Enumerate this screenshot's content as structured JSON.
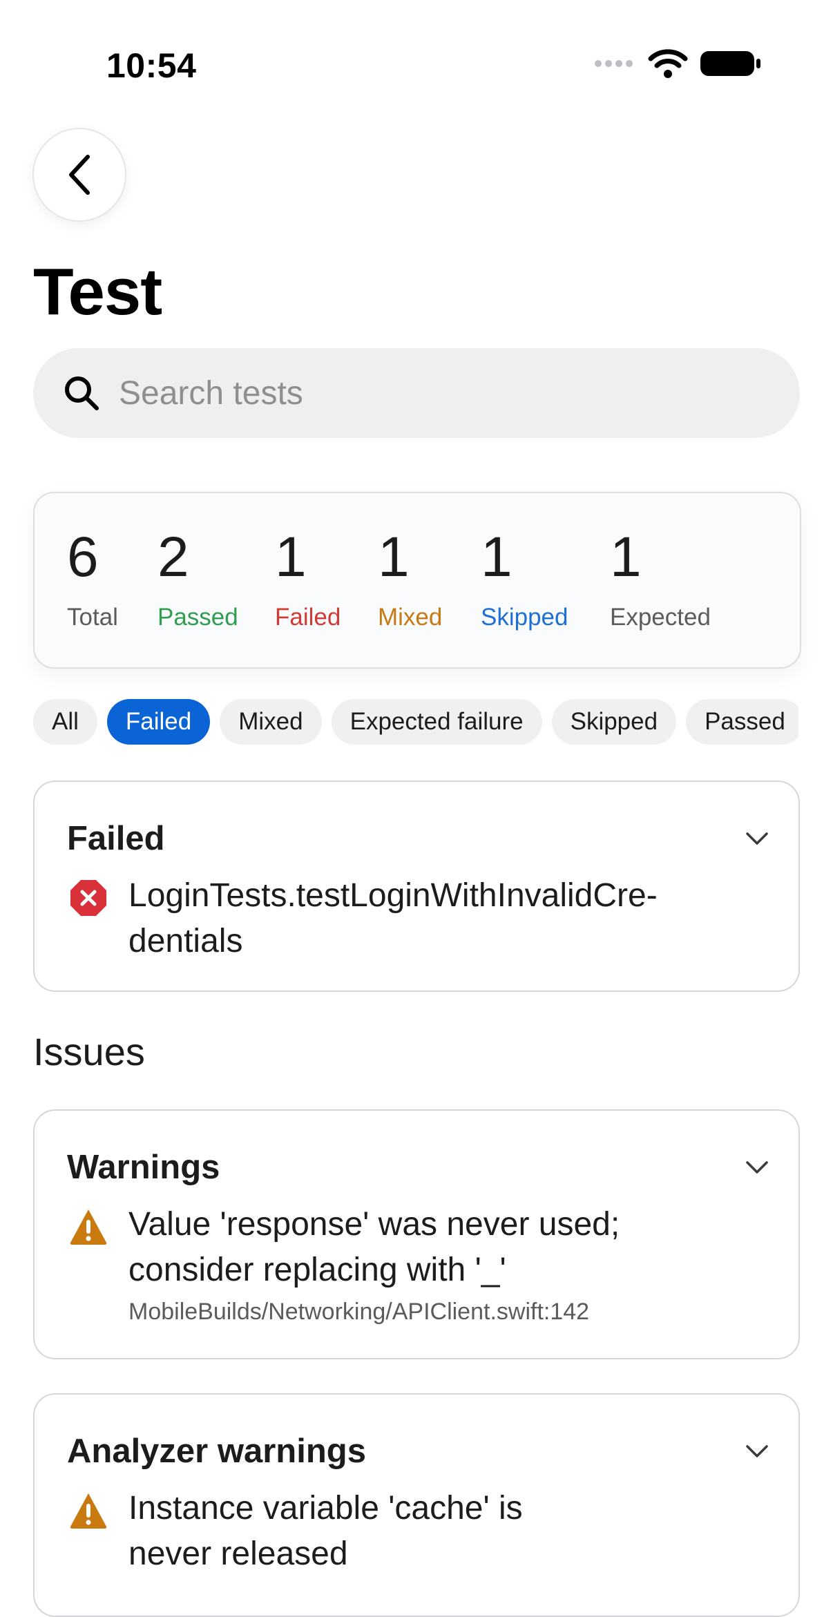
{
  "status": {
    "time": "10:54"
  },
  "header": {
    "title": "Test"
  },
  "search": {
    "placeholder": "Search tests"
  },
  "summary": [
    {
      "value": "6",
      "label": "Total",
      "color": "#5a5a5f"
    },
    {
      "value": "2",
      "label": "Passed",
      "color": "#2e9e4f"
    },
    {
      "value": "1",
      "label": "Failed",
      "color": "#d23b33"
    },
    {
      "value": "1",
      "label": "Mixed",
      "color": "#c87a12"
    },
    {
      "value": "1",
      "label": "Skipped",
      "color": "#1e6fd6"
    },
    {
      "value": "1",
      "label": "Expected",
      "color": "#5a5a5f"
    }
  ],
  "filters": {
    "selected": "Failed",
    "chips": [
      "All",
      "Failed",
      "Mixed",
      "Expected failure",
      "Skipped",
      "Passed"
    ]
  },
  "failed_card": {
    "title": "Failed",
    "item": "LoginTests.testLoginWithInvalidCre-\ndentials",
    "icon": "x-circle-icon"
  },
  "issues": {
    "title": "Issues",
    "warnings": {
      "title": "Warnings",
      "message": "Value 'response' was never used; consider replacing with '_'",
      "location": "MobileBuilds/Networking/APIClient.swift:142",
      "icon": "warning-triangle-icon"
    },
    "analyzer": {
      "title": "Analyzer warnings",
      "message": "Instance variable 'cache' is never released",
      "icon": "warning-triangle-icon"
    }
  },
  "colors": {
    "accent": "#0a64d6",
    "error": "#d8313a",
    "warning": "#c97a0e"
  }
}
